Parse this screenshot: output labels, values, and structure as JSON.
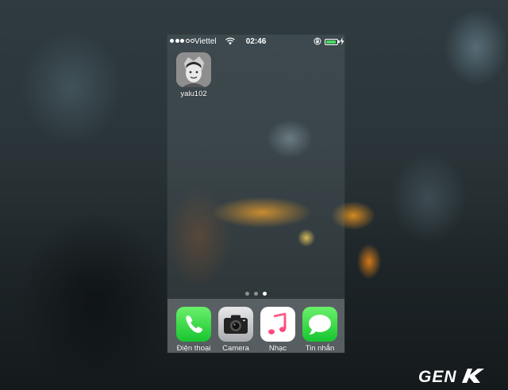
{
  "status_bar": {
    "carrier": "Viettel",
    "time": "02:46",
    "signal_bars_filled": 3,
    "signal_bars_total": 5,
    "battery_level": 0.9
  },
  "home_apps": [
    {
      "label": "yalu102",
      "icon": "yalu-avatar-icon"
    }
  ],
  "page_indicator": {
    "pages": 3,
    "current": 3
  },
  "dock": [
    {
      "label": "Điện thoại",
      "icon": "phone-icon"
    },
    {
      "label": "Camera",
      "icon": "camera-icon"
    },
    {
      "label": "Nhạc",
      "icon": "music-icon"
    },
    {
      "label": "Tin nhắn",
      "icon": "messages-icon"
    }
  ],
  "watermark": {
    "text": "GENK"
  },
  "colors": {
    "battery_green": "#4cd964",
    "phone_green": "#17c530",
    "music_pink": "#fc3c6e",
    "watermark_white": "#ffffff"
  }
}
